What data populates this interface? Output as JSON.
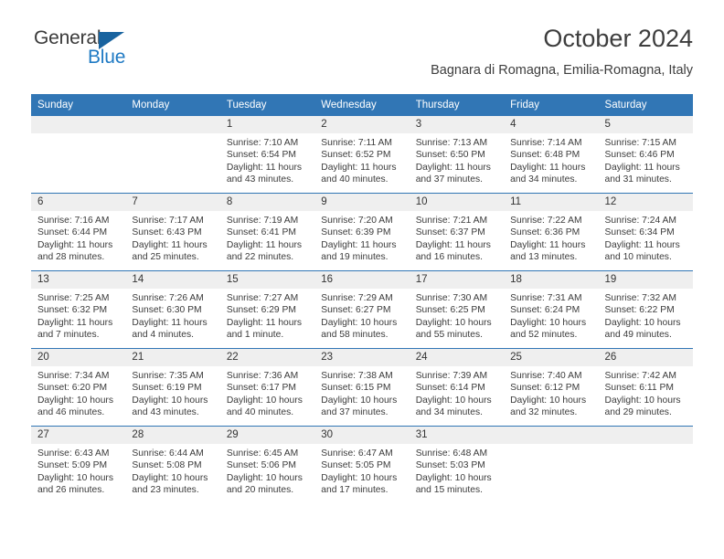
{
  "brand": {
    "name_part1": "General",
    "name_part2": "Blue",
    "logo_icon": "triangle-flag-icon",
    "accent_color": "#1f7ac4"
  },
  "header": {
    "title": "October 2024",
    "subtitle": "Bagnara di Romagna, Emilia-Romagna, Italy"
  },
  "theme": {
    "header_blue": "#3176b5",
    "daynum_band": "#efefef",
    "text": "#3b3b3b"
  },
  "weekday_headers": [
    "Sunday",
    "Monday",
    "Tuesday",
    "Wednesday",
    "Thursday",
    "Friday",
    "Saturday"
  ],
  "weeks": [
    [
      {
        "day": "",
        "sunrise": "",
        "sunset": "",
        "daylight_line1": "",
        "daylight_line2": "",
        "empty": true
      },
      {
        "day": "",
        "sunrise": "",
        "sunset": "",
        "daylight_line1": "",
        "daylight_line2": "",
        "empty": true
      },
      {
        "day": "1",
        "sunrise": "Sunrise: 7:10 AM",
        "sunset": "Sunset: 6:54 PM",
        "daylight_line1": "Daylight: 11 hours",
        "daylight_line2": "and 43 minutes."
      },
      {
        "day": "2",
        "sunrise": "Sunrise: 7:11 AM",
        "sunset": "Sunset: 6:52 PM",
        "daylight_line1": "Daylight: 11 hours",
        "daylight_line2": "and 40 minutes."
      },
      {
        "day": "3",
        "sunrise": "Sunrise: 7:13 AM",
        "sunset": "Sunset: 6:50 PM",
        "daylight_line1": "Daylight: 11 hours",
        "daylight_line2": "and 37 minutes."
      },
      {
        "day": "4",
        "sunrise": "Sunrise: 7:14 AM",
        "sunset": "Sunset: 6:48 PM",
        "daylight_line1": "Daylight: 11 hours",
        "daylight_line2": "and 34 minutes."
      },
      {
        "day": "5",
        "sunrise": "Sunrise: 7:15 AM",
        "sunset": "Sunset: 6:46 PM",
        "daylight_line1": "Daylight: 11 hours",
        "daylight_line2": "and 31 minutes."
      }
    ],
    [
      {
        "day": "6",
        "sunrise": "Sunrise: 7:16 AM",
        "sunset": "Sunset: 6:44 PM",
        "daylight_line1": "Daylight: 11 hours",
        "daylight_line2": "and 28 minutes."
      },
      {
        "day": "7",
        "sunrise": "Sunrise: 7:17 AM",
        "sunset": "Sunset: 6:43 PM",
        "daylight_line1": "Daylight: 11 hours",
        "daylight_line2": "and 25 minutes."
      },
      {
        "day": "8",
        "sunrise": "Sunrise: 7:19 AM",
        "sunset": "Sunset: 6:41 PM",
        "daylight_line1": "Daylight: 11 hours",
        "daylight_line2": "and 22 minutes."
      },
      {
        "day": "9",
        "sunrise": "Sunrise: 7:20 AM",
        "sunset": "Sunset: 6:39 PM",
        "daylight_line1": "Daylight: 11 hours",
        "daylight_line2": "and 19 minutes."
      },
      {
        "day": "10",
        "sunrise": "Sunrise: 7:21 AM",
        "sunset": "Sunset: 6:37 PM",
        "daylight_line1": "Daylight: 11 hours",
        "daylight_line2": "and 16 minutes."
      },
      {
        "day": "11",
        "sunrise": "Sunrise: 7:22 AM",
        "sunset": "Sunset: 6:36 PM",
        "daylight_line1": "Daylight: 11 hours",
        "daylight_line2": "and 13 minutes."
      },
      {
        "day": "12",
        "sunrise": "Sunrise: 7:24 AM",
        "sunset": "Sunset: 6:34 PM",
        "daylight_line1": "Daylight: 11 hours",
        "daylight_line2": "and 10 minutes."
      }
    ],
    [
      {
        "day": "13",
        "sunrise": "Sunrise: 7:25 AM",
        "sunset": "Sunset: 6:32 PM",
        "daylight_line1": "Daylight: 11 hours",
        "daylight_line2": "and 7 minutes."
      },
      {
        "day": "14",
        "sunrise": "Sunrise: 7:26 AM",
        "sunset": "Sunset: 6:30 PM",
        "daylight_line1": "Daylight: 11 hours",
        "daylight_line2": "and 4 minutes."
      },
      {
        "day": "15",
        "sunrise": "Sunrise: 7:27 AM",
        "sunset": "Sunset: 6:29 PM",
        "daylight_line1": "Daylight: 11 hours",
        "daylight_line2": "and 1 minute."
      },
      {
        "day": "16",
        "sunrise": "Sunrise: 7:29 AM",
        "sunset": "Sunset: 6:27 PM",
        "daylight_line1": "Daylight: 10 hours",
        "daylight_line2": "and 58 minutes."
      },
      {
        "day": "17",
        "sunrise": "Sunrise: 7:30 AM",
        "sunset": "Sunset: 6:25 PM",
        "daylight_line1": "Daylight: 10 hours",
        "daylight_line2": "and 55 minutes."
      },
      {
        "day": "18",
        "sunrise": "Sunrise: 7:31 AM",
        "sunset": "Sunset: 6:24 PM",
        "daylight_line1": "Daylight: 10 hours",
        "daylight_line2": "and 52 minutes."
      },
      {
        "day": "19",
        "sunrise": "Sunrise: 7:32 AM",
        "sunset": "Sunset: 6:22 PM",
        "daylight_line1": "Daylight: 10 hours",
        "daylight_line2": "and 49 minutes."
      }
    ],
    [
      {
        "day": "20",
        "sunrise": "Sunrise: 7:34 AM",
        "sunset": "Sunset: 6:20 PM",
        "daylight_line1": "Daylight: 10 hours",
        "daylight_line2": "and 46 minutes."
      },
      {
        "day": "21",
        "sunrise": "Sunrise: 7:35 AM",
        "sunset": "Sunset: 6:19 PM",
        "daylight_line1": "Daylight: 10 hours",
        "daylight_line2": "and 43 minutes."
      },
      {
        "day": "22",
        "sunrise": "Sunrise: 7:36 AM",
        "sunset": "Sunset: 6:17 PM",
        "daylight_line1": "Daylight: 10 hours",
        "daylight_line2": "and 40 minutes."
      },
      {
        "day": "23",
        "sunrise": "Sunrise: 7:38 AM",
        "sunset": "Sunset: 6:15 PM",
        "daylight_line1": "Daylight: 10 hours",
        "daylight_line2": "and 37 minutes."
      },
      {
        "day": "24",
        "sunrise": "Sunrise: 7:39 AM",
        "sunset": "Sunset: 6:14 PM",
        "daylight_line1": "Daylight: 10 hours",
        "daylight_line2": "and 34 minutes."
      },
      {
        "day": "25",
        "sunrise": "Sunrise: 7:40 AM",
        "sunset": "Sunset: 6:12 PM",
        "daylight_line1": "Daylight: 10 hours",
        "daylight_line2": "and 32 minutes."
      },
      {
        "day": "26",
        "sunrise": "Sunrise: 7:42 AM",
        "sunset": "Sunset: 6:11 PM",
        "daylight_line1": "Daylight: 10 hours",
        "daylight_line2": "and 29 minutes."
      }
    ],
    [
      {
        "day": "27",
        "sunrise": "Sunrise: 6:43 AM",
        "sunset": "Sunset: 5:09 PM",
        "daylight_line1": "Daylight: 10 hours",
        "daylight_line2": "and 26 minutes."
      },
      {
        "day": "28",
        "sunrise": "Sunrise: 6:44 AM",
        "sunset": "Sunset: 5:08 PM",
        "daylight_line1": "Daylight: 10 hours",
        "daylight_line2": "and 23 minutes."
      },
      {
        "day": "29",
        "sunrise": "Sunrise: 6:45 AM",
        "sunset": "Sunset: 5:06 PM",
        "daylight_line1": "Daylight: 10 hours",
        "daylight_line2": "and 20 minutes."
      },
      {
        "day": "30",
        "sunrise": "Sunrise: 6:47 AM",
        "sunset": "Sunset: 5:05 PM",
        "daylight_line1": "Daylight: 10 hours",
        "daylight_line2": "and 17 minutes."
      },
      {
        "day": "31",
        "sunrise": "Sunrise: 6:48 AM",
        "sunset": "Sunset: 5:03 PM",
        "daylight_line1": "Daylight: 10 hours",
        "daylight_line2": "and 15 minutes."
      },
      {
        "day": "",
        "sunrise": "",
        "sunset": "",
        "daylight_line1": "",
        "daylight_line2": "",
        "empty": true
      },
      {
        "day": "",
        "sunrise": "",
        "sunset": "",
        "daylight_line1": "",
        "daylight_line2": "",
        "empty": true
      }
    ]
  ]
}
